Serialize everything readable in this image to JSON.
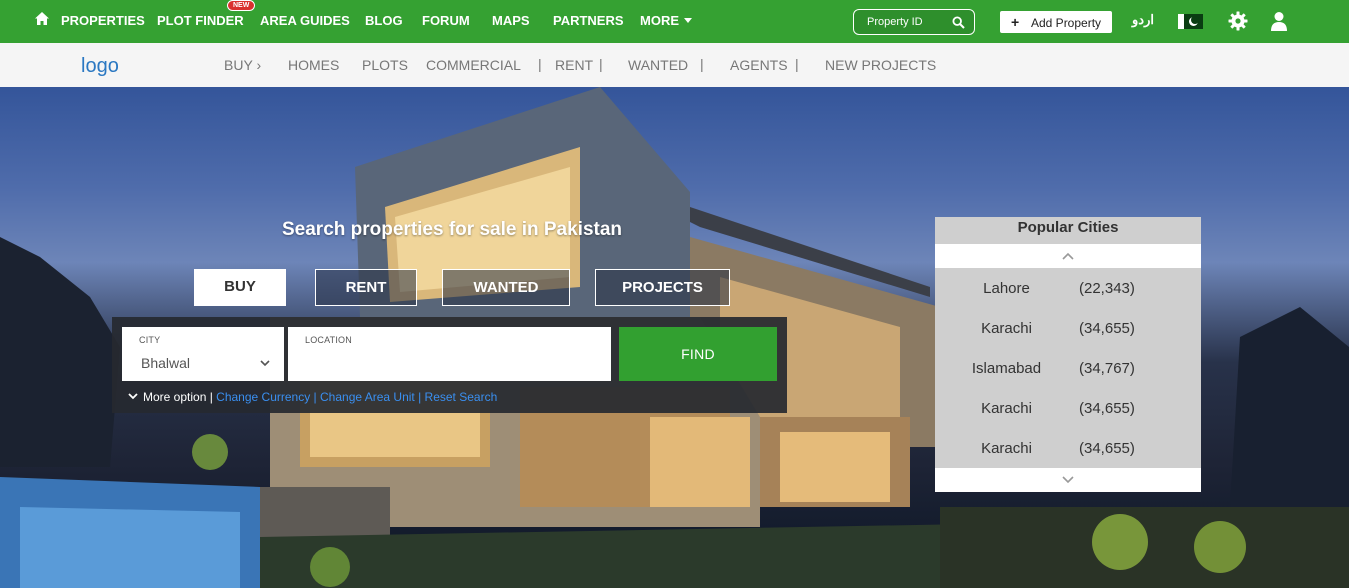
{
  "topnav": {
    "properties": "PROPERTIES",
    "plot_finder": "PLOT FINDER",
    "new_badge": "NEW",
    "area_guides": "AREA GUIDES",
    "blog": "BLOG",
    "forum": "FORUM",
    "maps": "MAPS",
    "partners": "PARTNERS",
    "more": "MORE",
    "property_id_placeholder": "Property ID",
    "add_property": "Add Property",
    "urdu": "اردو"
  },
  "subnav": {
    "logo": "logo",
    "buy": "BUY",
    "homes": "HOMES",
    "plots": "PLOTS",
    "commercial": "COMMERCIAL",
    "rent": "RENT",
    "wanted": "WANTED",
    "agents": "AGENTS",
    "new_projects": "NEW PROJECTS"
  },
  "hero": {
    "title": "Search properties for sale in Pakistan",
    "tabs": [
      {
        "label": "BUY"
      },
      {
        "label": "RENT"
      },
      {
        "label": "WANTED"
      },
      {
        "label": "PROJECTS"
      }
    ]
  },
  "search": {
    "city_label": "CITY",
    "city_value": "Bhalwal",
    "location_label": "LOCATION",
    "location_value": "",
    "find": "FIND",
    "more_option": "More option |",
    "change_currency": "Change Currency |",
    "change_area_unit": "Change Area Unit |",
    "reset_search": "Reset Search"
  },
  "popular_cities": {
    "title": "Popular Cities",
    "items": [
      {
        "name": "Lahore",
        "count": "(22,343)"
      },
      {
        "name": "Karachi",
        "count": "(34,655)"
      },
      {
        "name": "Islamabad",
        "count": "(34,767)"
      },
      {
        "name": "Karachi",
        "count": "(34,655)"
      },
      {
        "name": "Karachi",
        "count": "(34,655)"
      }
    ]
  },
  "colors": {
    "brand_green": "#35a132",
    "link_blue": "#3a8ff0"
  }
}
